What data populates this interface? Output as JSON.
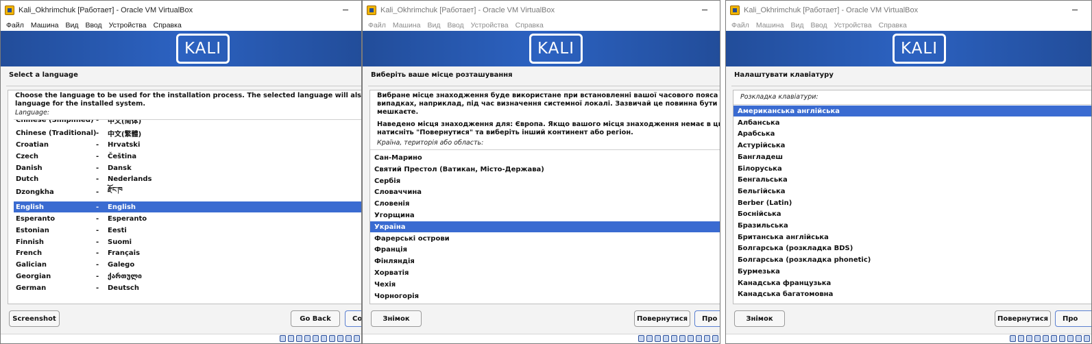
{
  "windows": [
    {
      "title": "Kali_Okhrimchuk [Работает] - Oracle VM VirtualBox",
      "menu": [
        "Файл",
        "Машина",
        "Вид",
        "Ввод",
        "Устройства",
        "Справка"
      ],
      "logo": "KALI",
      "heading": "Select a language",
      "description": "Choose the language to be used for the installation process. The selected language will also be the de\nlanguage for the installed system.",
      "list_label": "Language:",
      "list": [
        {
          "name": "Chinese (Simplified)",
          "sep": "-",
          "native": "中文(简体)"
        },
        {
          "name": "Chinese (Traditional)",
          "sep": "-",
          "native": "中文(繁體)"
        },
        {
          "name": "Croatian",
          "sep": "-",
          "native": "Hrvatski"
        },
        {
          "name": "Czech",
          "sep": "-",
          "native": "Čeština"
        },
        {
          "name": "Danish",
          "sep": "-",
          "native": "Dansk"
        },
        {
          "name": "Dutch",
          "sep": "-",
          "native": "Nederlands"
        },
        {
          "name": "Dzongkha",
          "sep": "-",
          "native": "རྫོང་ཁ"
        },
        {
          "name": "English",
          "sep": "-",
          "native": "English"
        },
        {
          "name": "Esperanto",
          "sep": "-",
          "native": "Esperanto"
        },
        {
          "name": "Estonian",
          "sep": "-",
          "native": "Eesti"
        },
        {
          "name": "Finnish",
          "sep": "-",
          "native": "Suomi"
        },
        {
          "name": "French",
          "sep": "-",
          "native": "Français"
        },
        {
          "name": "Galician",
          "sep": "-",
          "native": "Galego"
        },
        {
          "name": "Georgian",
          "sep": "-",
          "native": "ქართული"
        },
        {
          "name": "German",
          "sep": "-",
          "native": "Deutsch"
        }
      ],
      "selected": "English",
      "buttons": {
        "screenshot": "Screenshot",
        "back": "Go Back",
        "next": "Co"
      }
    },
    {
      "title": "Kali_Okhrimchuk [Работает] - Oracle VM VirtualBox",
      "menu": [
        "Файл",
        "Машина",
        "Вид",
        "Ввод",
        "Устройства",
        "Справка"
      ],
      "logo": "KALI",
      "heading": "Виберіть ваше місце розташування",
      "description": "Вибране місце знаходження буде використане при встановленні вашої часового пояса та в деяких і\nвипадках, наприклад, під час визначення системної локалі. Зазвичай це повинна бути країна, в які\nмешкаєте.",
      "description2": "Наведено місця знаходження для: Європа. Якщо вашого місця знаходження немає в цьому списку\nнатисніть \"Повернутися\" та виберіть інший континент або регіон.",
      "list_label": "Країна, територія або область:",
      "list": [
        "Сан-Марино",
        "Святий Престол (Ватикан, Місто-Держава)",
        "Сербія",
        "Словаччина",
        "Словенія",
        "Угорщина",
        "Україна",
        "Фарерські острови",
        "Франція",
        "Фінляндія",
        "Хорватія",
        "Чехія",
        "Чорногорія"
      ],
      "selected": "Україна",
      "buttons": {
        "screenshot": "Знімок",
        "back": "Повернутися",
        "next": "Про"
      }
    },
    {
      "title": "Kali_Okhrimchuk [Работает] - Oracle VM VirtualBox",
      "menu": [
        "Файл",
        "Машина",
        "Вид",
        "Ввод",
        "Устройства",
        "Справка"
      ],
      "logo": "KALI",
      "heading": "Налаштувати клавіатуру",
      "list_label": "Розкладка клавіатури:",
      "list": [
        "Американська англійська",
        "Албанська",
        "Арабська",
        "Астурійська",
        "Бангладеш",
        "Білоруська",
        "Бенгальська",
        "Бельгійська",
        "Berber (Latin)",
        "Боснійська",
        "Бразильська",
        "Британська англійська",
        "Болгарська (розкладка BDS)",
        "Болгарська (розкладка phonetic)",
        "Бурмезька",
        "Канадська французька",
        "Канадська багатомовна"
      ],
      "selected": "Американська англійська",
      "buttons": {
        "screenshot": "Знімок",
        "back": "Повернутися",
        "next": "Про"
      }
    }
  ],
  "colors": {
    "banner": "#2c62c1",
    "selection": "#3a6bd1"
  }
}
